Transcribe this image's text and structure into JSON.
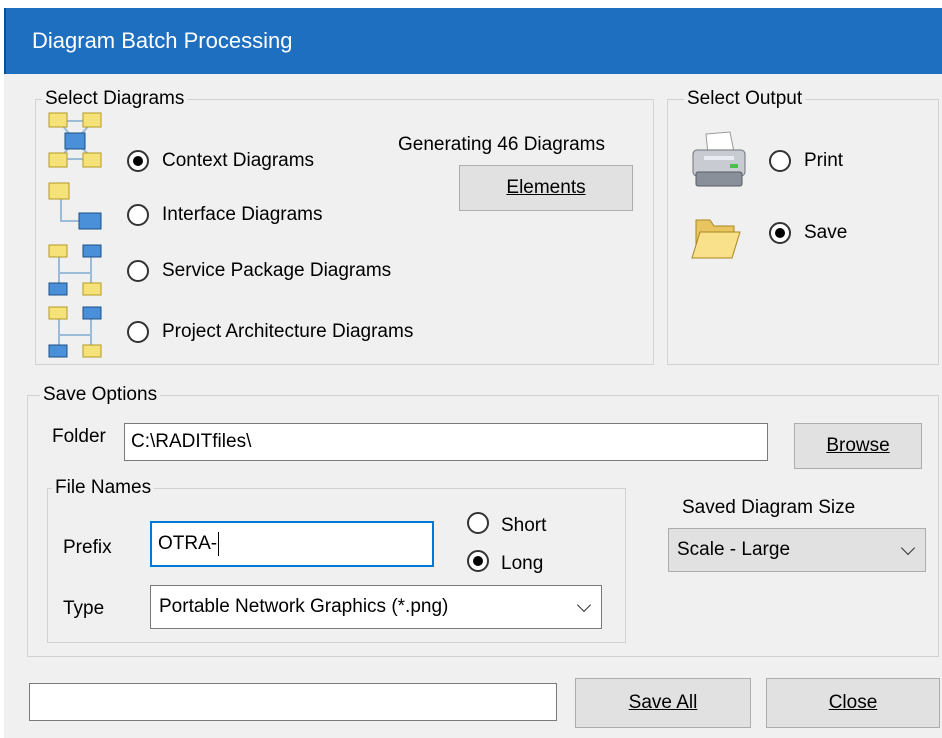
{
  "window": {
    "title": "Diagram Batch Processing"
  },
  "select_diagrams": {
    "legend": "Select Diagrams",
    "generating_text": "Generating 46 Diagrams",
    "elements_button": "Elements",
    "options": [
      {
        "label": "Context Diagrams",
        "checked": true,
        "icon": "context-diagram-icon"
      },
      {
        "label": "Interface Diagrams",
        "checked": false,
        "icon": "interface-diagram-icon"
      },
      {
        "label": "Service Package Diagrams",
        "checked": false,
        "icon": "service-package-diagram-icon"
      },
      {
        "label": "Project Architecture Diagrams",
        "checked": false,
        "icon": "project-architecture-diagram-icon"
      }
    ]
  },
  "select_output": {
    "legend": "Select Output",
    "options": [
      {
        "label": "Print",
        "checked": false,
        "icon": "printer-icon"
      },
      {
        "label": "Save",
        "checked": true,
        "icon": "folder-icon"
      }
    ]
  },
  "save_options": {
    "legend": "Save Options",
    "folder_label": "Folder",
    "folder_value": "C:\\RADITfiles\\",
    "browse_button": "Browse",
    "file_names": {
      "legend": "File Names",
      "prefix_label": "Prefix",
      "prefix_value": "OTRA-",
      "name_length_options": [
        {
          "label": "Short",
          "checked": false
        },
        {
          "label": "Long",
          "checked": true
        }
      ],
      "type_label": "Type",
      "type_value": "Portable Network Graphics (*.png)"
    },
    "size_label": "Saved Diagram Size",
    "size_value": "Scale - Large"
  },
  "footer": {
    "status_value": "",
    "save_all_button": "Save All",
    "close_button": "Close"
  },
  "colors": {
    "titlebar": "#1f6fc0",
    "focus": "#0078d7",
    "face": "#f0f0f0"
  }
}
